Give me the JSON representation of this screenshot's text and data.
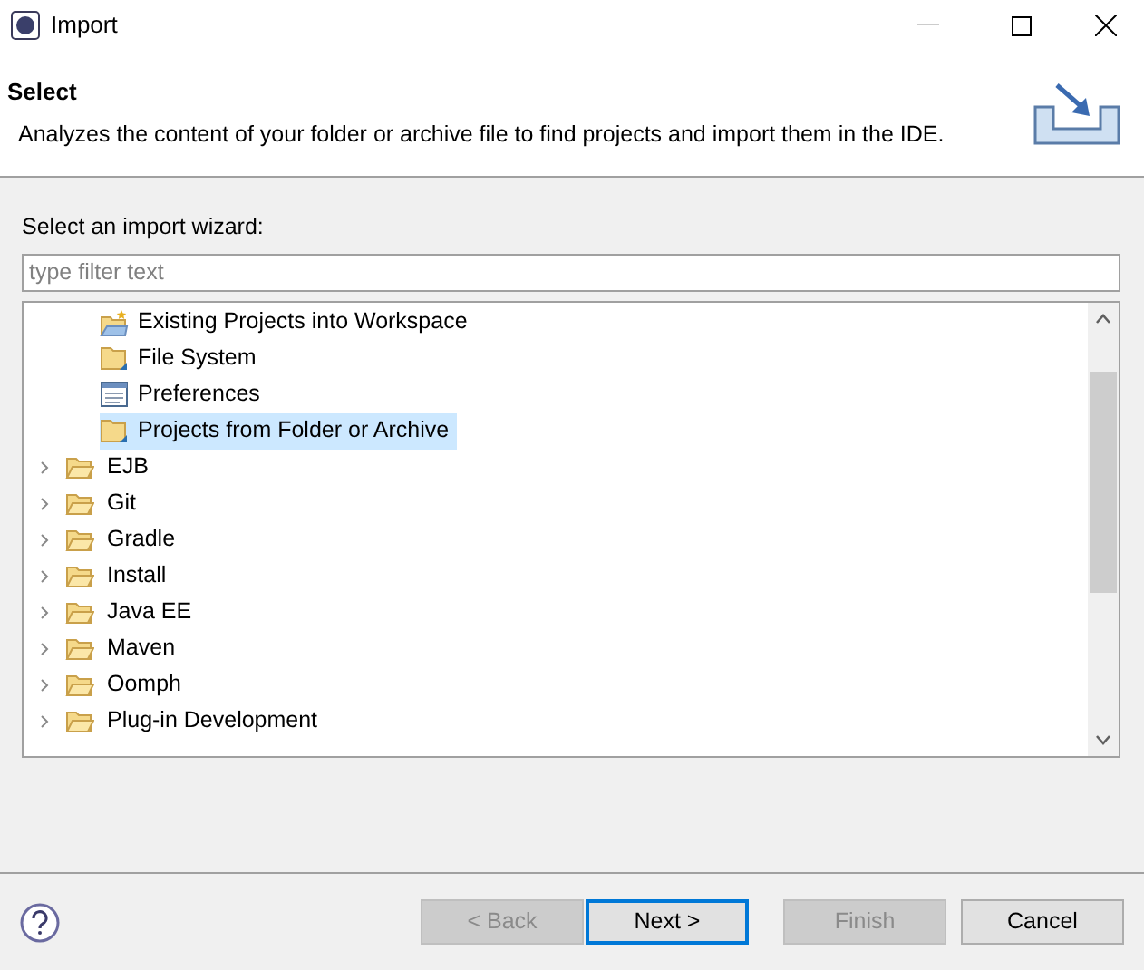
{
  "window": {
    "title": "Import"
  },
  "header": {
    "title": "Select",
    "description": "Analyzes the content of your folder or archive file to find projects and import them in the IDE."
  },
  "wizard_label": "Select an import wizard:",
  "filter": {
    "placeholder": "type filter text"
  },
  "tree": {
    "open_group_items": [
      {
        "label": "Existing Projects into Workspace",
        "kind": "projects",
        "selected": false
      },
      {
        "label": "File System",
        "kind": "folder",
        "selected": false
      },
      {
        "label": "Preferences",
        "kind": "preferences",
        "selected": false
      },
      {
        "label": "Projects from Folder or Archive",
        "kind": "folder",
        "selected": true
      }
    ],
    "groups": [
      {
        "label": "EJB",
        "expanded": false
      },
      {
        "label": "Git",
        "expanded": false
      },
      {
        "label": "Gradle",
        "expanded": false
      },
      {
        "label": "Install",
        "expanded": false
      },
      {
        "label": "Java EE",
        "expanded": false
      },
      {
        "label": "Maven",
        "expanded": false
      },
      {
        "label": "Oomph",
        "expanded": false
      },
      {
        "label": "Plug-in Development",
        "expanded": false
      }
    ]
  },
  "buttons": [
    {
      "label": "< Back",
      "disabled": true,
      "default": false
    },
    {
      "label": "Next >",
      "disabled": false,
      "default": true
    },
    {
      "label": "Finish",
      "disabled": true,
      "default": false
    },
    {
      "label": "Cancel",
      "disabled": false,
      "default": false
    }
  ]
}
